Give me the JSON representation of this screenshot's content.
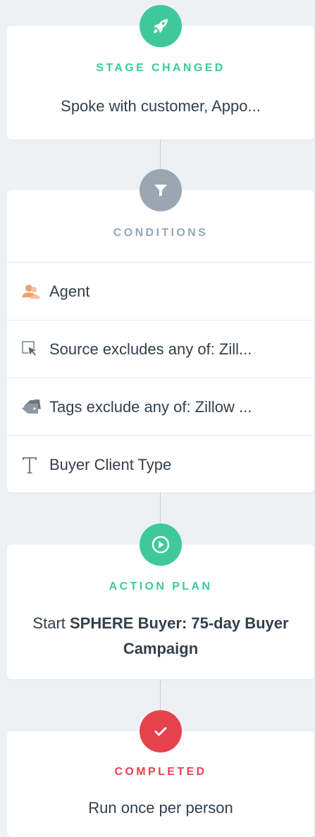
{
  "trigger": {
    "label": "STAGE CHANGED",
    "subtext": "Spoke with customer, Appo...",
    "color": "#3fc99b",
    "icon": "rocket-icon"
  },
  "conditions": {
    "label": "CONDITIONS",
    "color": "#9aa6b1",
    "icon": "filter-icon",
    "items": [
      {
        "text": "Agent",
        "icon": "agent-icon"
      },
      {
        "text": "Source excludes any of: Zill...",
        "icon": "cursor-icon"
      },
      {
        "text": "Tags exclude any of: Zillow ...",
        "icon": "tag-icon"
      },
      {
        "text": "Buyer Client Type",
        "icon": "text-icon"
      }
    ]
  },
  "action_plan": {
    "label": "ACTION PLAN",
    "prefix": "Start ",
    "plan_name": "SPHERE Buyer: 75-day Buyer Campaign",
    "color": "#3fc99b",
    "icon": "play-icon"
  },
  "completed": {
    "label": "COMPLETED",
    "subtext": "Run once per person",
    "color": "#e8414e",
    "icon": "check-icon"
  }
}
